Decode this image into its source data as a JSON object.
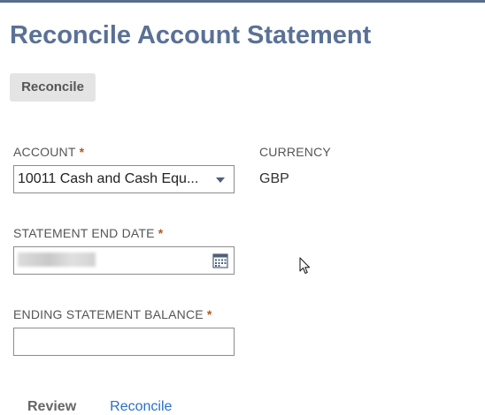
{
  "page": {
    "title": "Reconcile Account Statement",
    "reconcile_button": "Reconcile"
  },
  "form": {
    "account": {
      "label": "ACCOUNT",
      "required_mark": "*",
      "value": "10011 Cash and Cash Equ..."
    },
    "currency": {
      "label": "CURRENCY",
      "value": "GBP"
    },
    "statement_end_date": {
      "label": "STATEMENT END DATE",
      "required_mark": "*",
      "icon": "calendar-icon"
    },
    "ending_statement_balance": {
      "label": "ENDING STATEMENT BALANCE",
      "required_mark": "*",
      "value": ""
    }
  },
  "tabs": [
    {
      "label": "Review"
    },
    {
      "label": "Reconcile"
    }
  ],
  "colors": {
    "title": "#5a7196",
    "required": "#b05a22",
    "link": "#2a6fc9"
  }
}
